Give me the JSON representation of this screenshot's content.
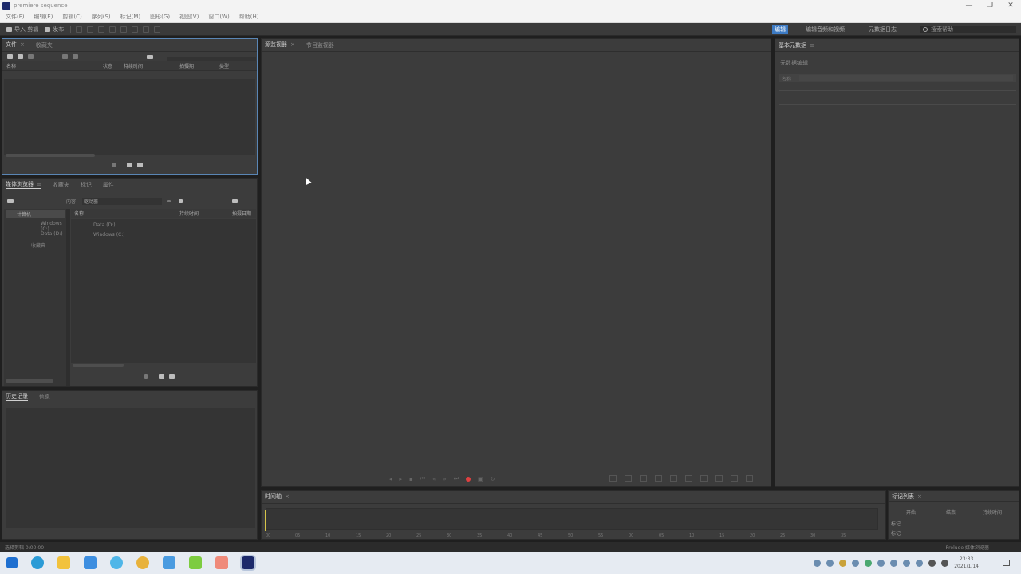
{
  "window": {
    "title": "premiere sequence",
    "controls": [
      "—",
      "❐",
      "✕"
    ]
  },
  "menu": [
    "文件(F)",
    "编辑(E)",
    "剪辑(C)",
    "序列(S)",
    "标记(M)",
    "图形(G)",
    "视图(V)",
    "窗口(W)",
    "帮助(H)"
  ],
  "toolbar": {
    "left_buttons": [
      "导入 剪辑",
      "发布"
    ],
    "workspaces": [
      "编辑",
      "编辑音频和视频",
      "元数据日志"
    ],
    "search_placeholder": "搜索帮助"
  },
  "project_panel": {
    "tabs": [
      "文件",
      "收藏夹"
    ],
    "columns": [
      "名称",
      "状态",
      "持续时间",
      "拍摄期",
      "类型"
    ]
  },
  "media_browser": {
    "tabs": [
      "媒体浏览器",
      "收藏夹",
      "标记",
      "属性"
    ],
    "location_label": "内容",
    "location_value": "驱动器",
    "tree": [
      "计算机",
      "Windows (C:)",
      "Data (D:)",
      "收藏夹"
    ],
    "columns": [
      "名称",
      "持续时间",
      "拍摄日期"
    ],
    "files": [
      "Data (D:)",
      "Windows (C:)"
    ]
  },
  "history_panel": {
    "tabs": [
      "历史记录",
      "信息"
    ]
  },
  "monitor": {
    "tabs": [
      "源监视器",
      "节目监视器"
    ]
  },
  "timeline": {
    "tab": "时间轴",
    "ticks": [
      "00",
      "05",
      "10",
      "15",
      "20",
      "25",
      "30",
      "35",
      "40",
      "45",
      "50",
      "55",
      "00",
      "05",
      "10",
      "15",
      "20",
      "25",
      "30",
      "35"
    ]
  },
  "metadata_panel": {
    "tab": "基本元数据",
    "section": "元数据编辑",
    "field_label": "名称"
  },
  "markers_panel": {
    "tab": "标记列表",
    "columns": [
      "开始",
      "结束",
      "持续时间"
    ],
    "rows": [
      "标记",
      "标记"
    ]
  },
  "status": {
    "left": "选择剪辑 0:00:00",
    "right": "Prelude 媒体浏览器"
  },
  "taskbar": {
    "clock_time": "23:33",
    "clock_date": "2021/1/14"
  },
  "colors": {
    "accent": "#3d7bc4",
    "record": "#e04040",
    "panel": "#3c3c3c"
  }
}
